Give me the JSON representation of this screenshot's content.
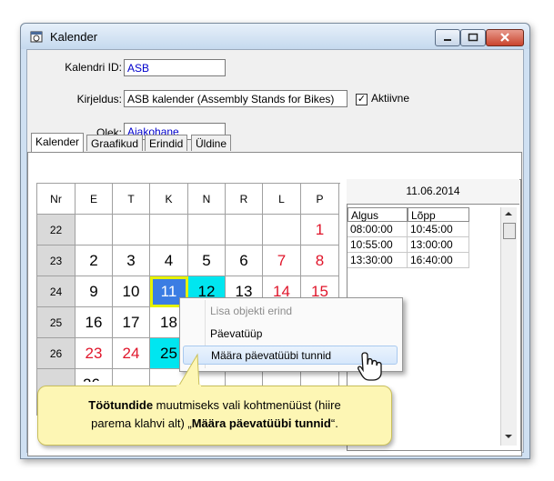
{
  "window": {
    "title": "Kalender"
  },
  "form": {
    "id_label": "Kalendri ID:",
    "id_value": "ASB",
    "desc_label": "Kirjeldus:",
    "desc_value": "ASB kalender (Assembly Stands for Bikes)",
    "active_check": "✓",
    "active_label": "Aktiivne",
    "state_label": "Olek:",
    "state_value": "Ajakohane"
  },
  "tabs": [
    "Kalender",
    "Graafikud",
    "Erindid",
    "Üldine"
  ],
  "calendar": {
    "headers": [
      "Nr",
      "E",
      "T",
      "K",
      "N",
      "R",
      "L",
      "P"
    ],
    "rows": [
      {
        "week": "22",
        "days": [
          "",
          "",
          "",
          "",
          "",
          "",
          "1"
        ]
      },
      {
        "week": "23",
        "days": [
          "2",
          "3",
          "4",
          "5",
          "6",
          "7",
          "8"
        ]
      },
      {
        "week": "24",
        "days": [
          "9",
          "10",
          "11",
          "12",
          "13",
          "14",
          "15"
        ]
      },
      {
        "week": "25",
        "days": [
          "16",
          "17",
          "18",
          "",
          "",
          "",
          ""
        ]
      },
      {
        "week": "26",
        "days": [
          "23",
          "24",
          "25",
          "",
          "",
          "",
          ""
        ]
      },
      {
        "week": "",
        "days": [
          "",
          "",
          "",
          "",
          "",
          "",
          ""
        ]
      }
    ],
    "partial_bottom": "26"
  },
  "schedule": {
    "date": "11.06.2014",
    "columns": [
      "Algus",
      "Lõpp"
    ],
    "rows": [
      [
        "08:00:00",
        "10:45:00"
      ],
      [
        "10:55:00",
        "13:00:00"
      ],
      [
        "13:30:00",
        "16:40:00"
      ]
    ]
  },
  "context_menu": {
    "items": [
      "Lisa objekti erind",
      "Päevatüüp",
      "Määra päevatüübi tunnid"
    ]
  },
  "callout": {
    "bold1": "Töötundide",
    "text1": " muutmiseks vali kohtmenüüst (hiire",
    "text2": "parema klahvi alt) „",
    "bold2": "Määra päevatüübi tunnid",
    "text3": "“."
  },
  "colors": {
    "weekend_red": "#e0162b",
    "highlight_cyan": "#00e6f0",
    "selected_blue": "#3b7de3",
    "selected_outline": "#e6f200",
    "callout_bg": "#fdf6b4"
  }
}
